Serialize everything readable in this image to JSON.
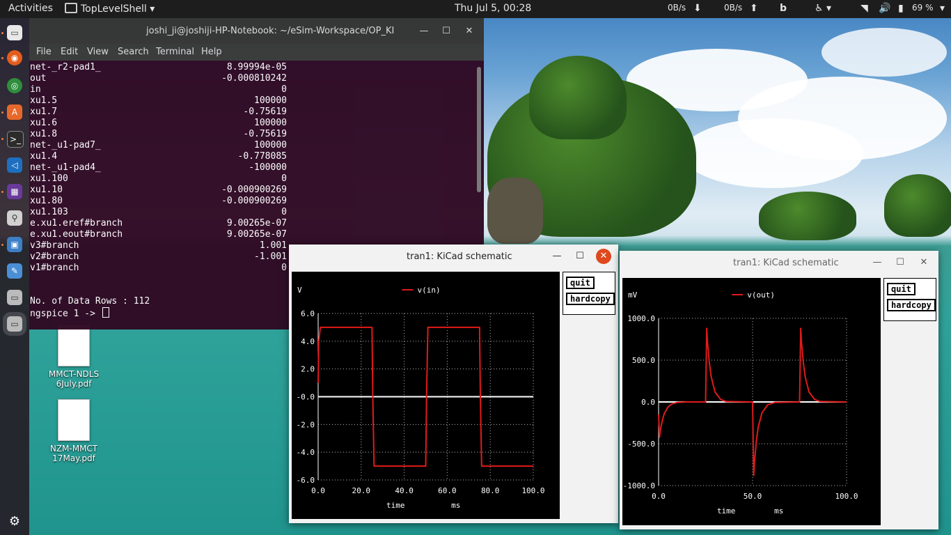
{
  "topbar": {
    "activities": "Activities",
    "app_menu": "TopLevelShell",
    "clock": "Thu Jul  5, 00:28",
    "net_down": "0B/s",
    "net_up": "0B/s",
    "battery": "69 %"
  },
  "desktop_icons": [
    {
      "line1": "MMCT-NDLS",
      "line2": "6July.pdf"
    },
    {
      "line1": "NZM-MMCT",
      "line2": "17May.pdf"
    }
  ],
  "terminal": {
    "title": "joshi_ji@joshiji-HP-Notebook: ~/eSim-Workspace/OP_KI",
    "menu": [
      "File",
      "Edit",
      "View",
      "Search",
      "Terminal",
      "Help"
    ],
    "rows": [
      {
        "name": "net-_r2-pad1_",
        "value": "8.99994e-05"
      },
      {
        "name": "out",
        "value": "-0.000810242"
      },
      {
        "name": "in",
        "value": "0"
      },
      {
        "name": "xu1.5",
        "value": "100000"
      },
      {
        "name": "xu1.7",
        "value": "-0.75619"
      },
      {
        "name": "xu1.6",
        "value": "100000"
      },
      {
        "name": "xu1.8",
        "value": "-0.75619"
      },
      {
        "name": "net-_u1-pad7_",
        "value": "100000"
      },
      {
        "name": "xu1.4",
        "value": "-0.778085"
      },
      {
        "name": "net-_u1-pad4_",
        "value": "-100000"
      },
      {
        "name": "xu1.100",
        "value": "0"
      },
      {
        "name": "xu1.10",
        "value": "-0.000900269"
      },
      {
        "name": "xu1.80",
        "value": "-0.000900269"
      },
      {
        "name": "xu1.103",
        "value": "0"
      },
      {
        "name": "e.xu1.eref#branch",
        "value": "9.00265e-07"
      },
      {
        "name": "e.xu1.eout#branch",
        "value": "9.00265e-07"
      },
      {
        "name": "v3#branch",
        "value": "1.001"
      },
      {
        "name": "v2#branch",
        "value": "-1.001"
      },
      {
        "name": "v1#branch",
        "value": "0"
      }
    ],
    "data_rows_line": "No. of Data Rows : 112",
    "prompt": "ngspice 1 -> "
  },
  "plot_windows": [
    {
      "title": "tran1: KiCad schematic",
      "active": true,
      "buttons": {
        "quit": "quit",
        "hardcopy": "hardcopy"
      },
      "chart_data": {
        "type": "line",
        "unit_label": "V",
        "legend": "v(in)",
        "xlabel": "time",
        "xunit": "ms",
        "xlim": [
          0,
          100
        ],
        "ylim": [
          -6,
          6
        ],
        "xticks": [
          "0.0",
          "20.0",
          "40.0",
          "60.0",
          "80.0",
          "100.0"
        ],
        "yticks": [
          "6.0",
          "4.0",
          "2.0",
          "-0.0",
          "-2.0",
          "-4.0",
          "-6.0"
        ],
        "xtick_values": [
          0,
          20,
          40,
          60,
          80,
          100
        ],
        "ytick_values": [
          6,
          4,
          2,
          0,
          -2,
          -4,
          -6
        ],
        "grid": true,
        "series_color": "#e11a1a",
        "series": [
          {
            "name": "v(in)",
            "x": [
              0,
              0.3,
              1,
              25,
              25.4,
              26,
              50,
              50.4,
              51,
              75,
              75.4,
              76,
              100
            ],
            "y": [
              1,
              4,
              5,
              5,
              0,
              -5,
              -5,
              0,
              5,
              5,
              0,
              -5,
              -5
            ]
          }
        ]
      }
    },
    {
      "title": "tran1: KiCad schematic",
      "active": false,
      "buttons": {
        "quit": "quit",
        "hardcopy": "hardcopy"
      },
      "chart_data": {
        "type": "line",
        "unit_label": "mV",
        "legend": "v(out)",
        "xlabel": "time",
        "xunit": "ms",
        "xlim": [
          0,
          100
        ],
        "ylim": [
          -1000,
          1000
        ],
        "xticks": [
          "0.0",
          "50.0",
          "100.0"
        ],
        "yticks": [
          "1000.0",
          "500.0",
          "0.0",
          "-500.0",
          "-1000.0"
        ],
        "xtick_values": [
          0,
          50,
          100
        ],
        "ytick_values": [
          1000,
          500,
          0,
          -500,
          -1000
        ],
        "grid": true,
        "series_color": "#e11a1a",
        "series": [
          {
            "name": "v(out)",
            "x": [
              0,
              0.5,
              1,
              2,
              3,
              5,
              7,
              10,
              15,
              25,
              25.6,
              26,
              27,
              28,
              30,
              33,
              36,
              50,
              50.6,
              51,
              52,
              53,
              55,
              58,
              62,
              75,
              75.6,
              76,
              77,
              78,
              80,
              83,
              86,
              100
            ],
            "y": [
              -150,
              -420,
              -330,
              -220,
              -140,
              -60,
              -25,
              -5,
              0,
              0,
              880,
              720,
              470,
              300,
              120,
              30,
              5,
              0,
              -880,
              -720,
              -470,
              -300,
              -130,
              -35,
              -5,
              0,
              880,
              720,
              470,
              300,
              120,
              30,
              5,
              0
            ]
          }
        ]
      }
    }
  ]
}
